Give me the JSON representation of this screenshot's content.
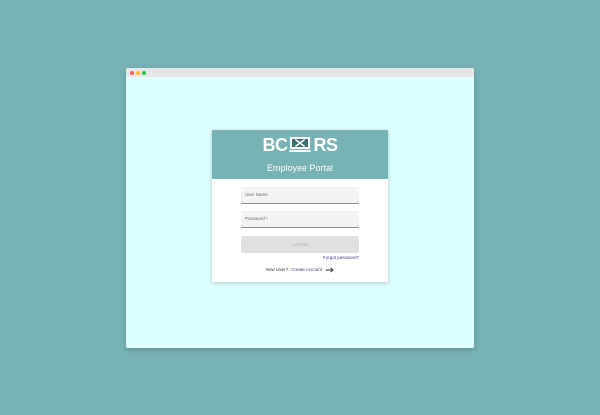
{
  "window": {
    "controls": [
      "close",
      "minimize",
      "maximize"
    ]
  },
  "logo": {
    "left_text": "BC",
    "right_text": "RS",
    "icon": "monitor-tools-icon"
  },
  "portal": {
    "title": "Employee Portal"
  },
  "form": {
    "username_label": "User Name",
    "password_label": "Password *",
    "login_label": "LOGIN",
    "forgot_label": "Forgot password?",
    "new_user_label": "New User?",
    "create_account_label": "Create Account"
  },
  "colors": {
    "background": "#77b2b4",
    "window": "#dcffff",
    "header": "#77b2b4",
    "link": "#4b3a8c"
  }
}
